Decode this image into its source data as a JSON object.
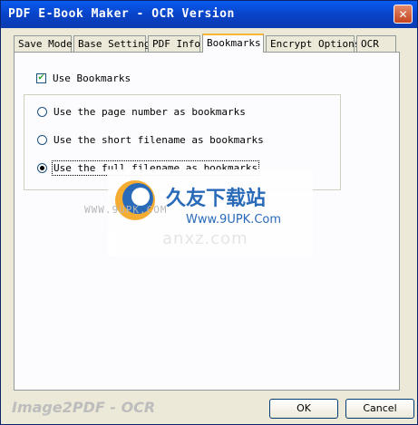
{
  "window": {
    "title": "PDF E-Book Maker - OCR Version",
    "close_glyph": "✕"
  },
  "tabs": [
    {
      "label": "Save Mode"
    },
    {
      "label": "Base Setting"
    },
    {
      "label": "PDF Info"
    },
    {
      "label": "Bookmarks",
      "active": true
    },
    {
      "label": "Encrypt Options"
    },
    {
      "label": "OCR"
    }
  ],
  "bookmarks": {
    "use_bookmarks_label": "Use Bookmarks",
    "use_bookmarks_checked": true,
    "check_glyph": "✔",
    "options": [
      {
        "label": "Use the page number as bookmarks",
        "selected": false
      },
      {
        "label": "Use the short filename as bookmarks",
        "selected": false
      },
      {
        "label": "Use the full filename as bookmarks",
        "selected": true
      }
    ]
  },
  "watermark": {
    "cn_text": "久友下载站",
    "url": "Www.9UPK.Com",
    "left_url": "WWW.9UPK.COM",
    "ghost": "anxz.com"
  },
  "footer": {
    "brand": "Image2PDF - OCR",
    "ok_label": "OK",
    "cancel_label": "Cancel"
  }
}
